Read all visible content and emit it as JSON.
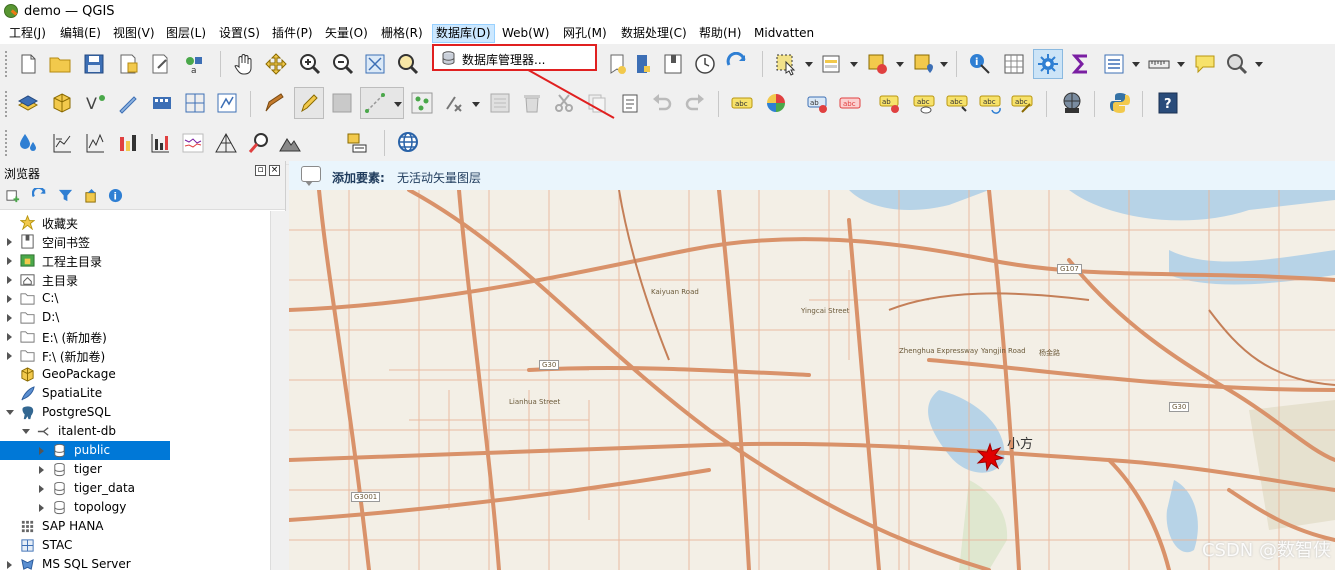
{
  "window": {
    "title": "demo — QGIS"
  },
  "menubar": {
    "items": [
      {
        "label": "工程(J)"
      },
      {
        "label": "编辑(E)"
      },
      {
        "label": "视图(V)"
      },
      {
        "label": "图层(L)"
      },
      {
        "label": "设置(S)"
      },
      {
        "label": "插件(P)"
      },
      {
        "label": "矢量(O)"
      },
      {
        "label": "栅格(R)"
      },
      {
        "label": "数据库(D)"
      },
      {
        "label": "Web(W)"
      },
      {
        "label": "网孔(M)"
      },
      {
        "label": "数据处理(C)"
      },
      {
        "label": "帮助(H)"
      },
      {
        "label": "Midvatten"
      }
    ],
    "active": "数据库(D)"
  },
  "database_menu": {
    "db_manager_label": "数据库管理器..."
  },
  "browser_panel": {
    "title": "浏览器",
    "tree": [
      {
        "label": "收藏夹"
      },
      {
        "label": "空间书签"
      },
      {
        "label": "工程主目录"
      },
      {
        "label": "主目录"
      },
      {
        "label": "C:\\"
      },
      {
        "label": "D:\\"
      },
      {
        "label": "E:\\ (新加卷)"
      },
      {
        "label": "F:\\ (新加卷)"
      },
      {
        "label": "GeoPackage"
      },
      {
        "label": "SpatiaLite"
      },
      {
        "label": "PostgreSQL"
      },
      {
        "label": "italent-db"
      },
      {
        "label": "public"
      },
      {
        "label": "tiger"
      },
      {
        "label": "tiger_data"
      },
      {
        "label": "topology"
      },
      {
        "label": "SAP HANA"
      },
      {
        "label": "STAC"
      },
      {
        "label": "MS SQL Server"
      }
    ],
    "selected": "public"
  },
  "message_bar": {
    "bold": "添加要素:",
    "message": "无活动矢量图层"
  },
  "map": {
    "labels": {
      "xiaofang": "小方",
      "g107": "G107",
      "g30a": "G30",
      "g30b": "G30",
      "g3001": "G3001",
      "kaiyuan": "Kaiyuan Road",
      "yingcai": "Yingcai Street",
      "lianhua": "Lianhua Street",
      "yangjin": "Yangjin Road",
      "zhenghua": "Zhenghua Expressway",
      "yangjin_cn": "杨金路"
    },
    "watermark": "CSDN @数智侠"
  },
  "colors": {
    "menu_active_bg": "#cce8ff",
    "highlight_red": "#e02020",
    "selection": "#0078d7",
    "road": "#d9926a",
    "water": "#b7d3e7"
  }
}
